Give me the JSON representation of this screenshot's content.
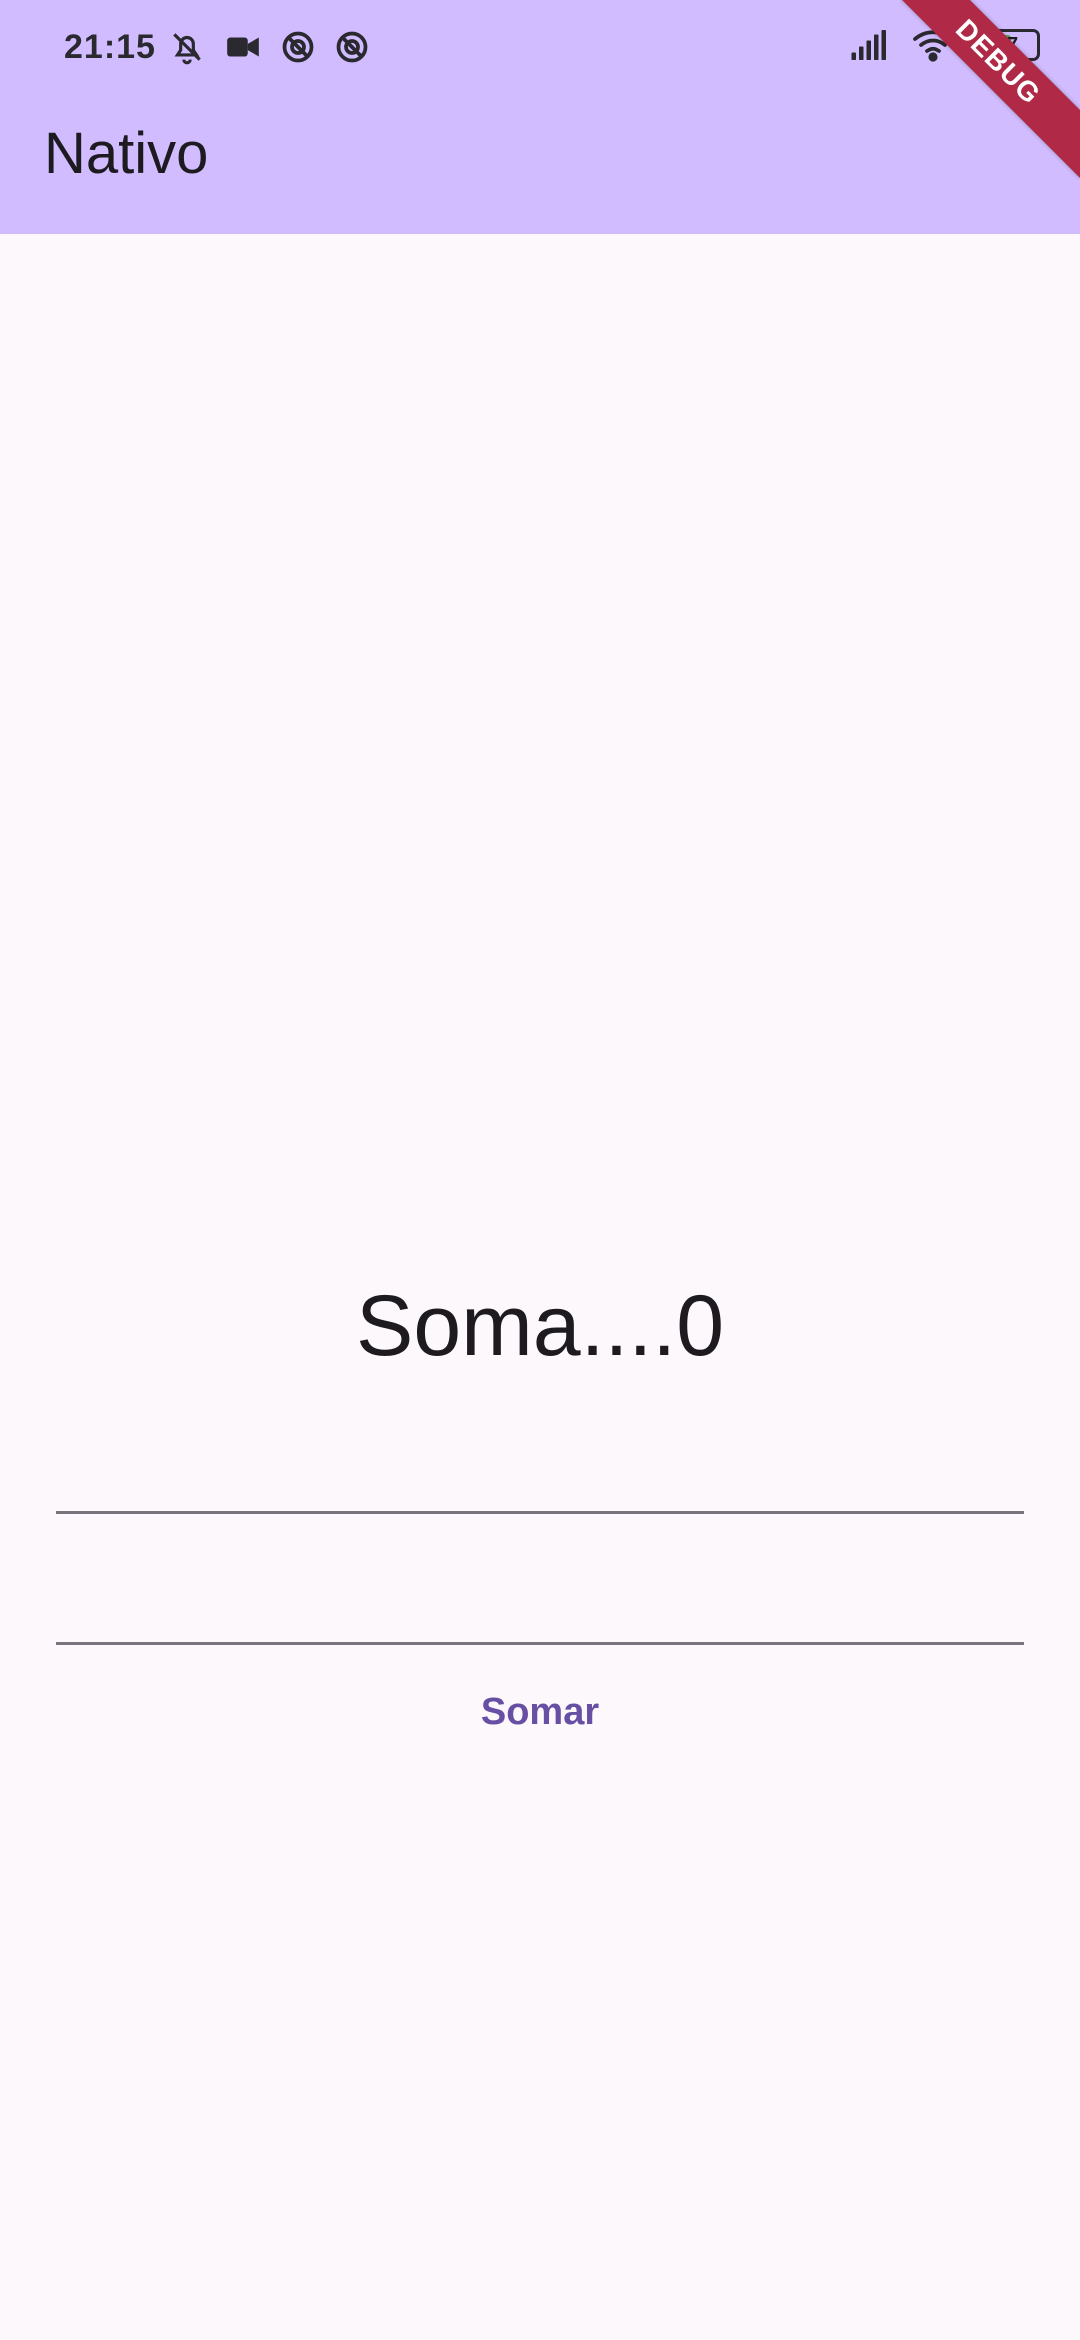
{
  "status_bar": {
    "time": "21:15",
    "battery_level": 57,
    "battery_text": "57",
    "left_icons": [
      "muted-bell-icon",
      "video-camera-icon",
      "blocked-app-icon",
      "blocked-app-icon"
    ],
    "right_icons": [
      "signal-icon",
      "wifi-icon",
      "battery-icon"
    ]
  },
  "app_bar": {
    "title": "Nativo",
    "debug_banner": "DEBUG"
  },
  "main": {
    "sum_label": "Soma....0",
    "first_input_value": "",
    "second_input_value": "",
    "sum_button_label": "Somar"
  },
  "colors": {
    "app_bar_background": "#d0bcff",
    "page_background": "#fdf8fc",
    "accent": "#6750a4",
    "debug_banner": "#b02a48",
    "input_underline": "#79747e"
  }
}
